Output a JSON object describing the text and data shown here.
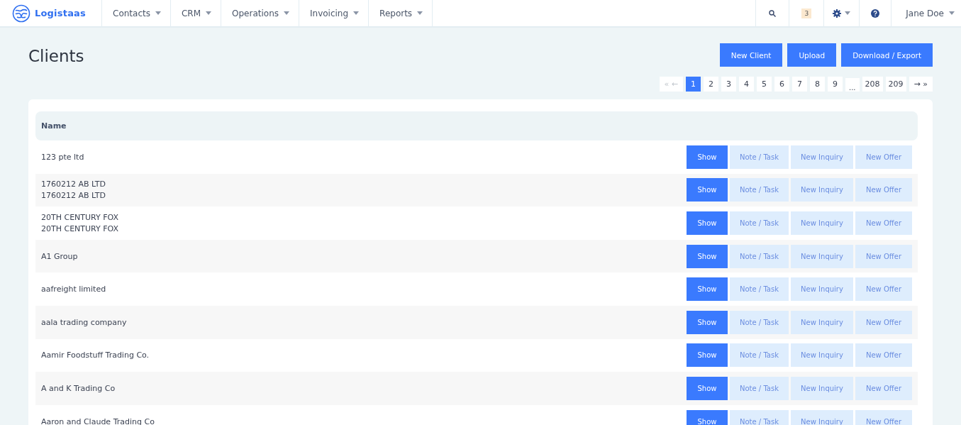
{
  "navbar": {
    "brand": "Logistaas",
    "menu": [
      {
        "label": "Contacts"
      },
      {
        "label": "CRM"
      },
      {
        "label": "Operations"
      },
      {
        "label": "Invoicing"
      },
      {
        "label": "Reports"
      }
    ],
    "notification_count": "3",
    "user": "Jane Doe"
  },
  "page": {
    "title": "Clients",
    "buttons": [
      "New Client",
      "Upload",
      "Download / Export"
    ]
  },
  "pagination": [
    {
      "kind": "prev",
      "label": "« ←",
      "disabled": true
    },
    {
      "kind": "page",
      "label": "1",
      "selected": true
    },
    {
      "kind": "page",
      "label": "2",
      "selected": false
    },
    {
      "kind": "page",
      "label": "3",
      "selected": false
    },
    {
      "kind": "page",
      "label": "4",
      "selected": false
    },
    {
      "kind": "page",
      "label": "5",
      "selected": false
    },
    {
      "kind": "page",
      "label": "6",
      "selected": false
    },
    {
      "kind": "page",
      "label": "7",
      "selected": false
    },
    {
      "kind": "page",
      "label": "8",
      "selected": false
    },
    {
      "kind": "page",
      "label": "9",
      "selected": false
    },
    {
      "kind": "ellipsis",
      "label": "..."
    },
    {
      "kind": "page",
      "label": "208",
      "selected": false
    },
    {
      "kind": "page",
      "label": "209",
      "selected": false
    },
    {
      "kind": "next",
      "label": "→ »",
      "disabled": false
    }
  ],
  "table": {
    "columns": [
      "Name"
    ],
    "rows": [
      {
        "name": [
          "123 pte ltd"
        ],
        "actions": [
          "Show",
          "Note / Task",
          "New Inquiry",
          "New Offer"
        ]
      },
      {
        "name": [
          "1760212 AB LTD",
          "1760212 AB LTD"
        ],
        "actions": [
          "Show",
          "Note / Task",
          "New Inquiry",
          "New Offer"
        ]
      },
      {
        "name": [
          "20TH CENTURY FOX",
          "20TH CENTURY FOX"
        ],
        "actions": [
          "Show",
          "Note / Task",
          "New Inquiry",
          "New Offer"
        ]
      },
      {
        "name": [
          "A1 Group"
        ],
        "actions": [
          "Show",
          "Note / Task",
          "New Inquiry",
          "New Offer"
        ]
      },
      {
        "name": [
          "aafreight limited"
        ],
        "actions": [
          "Show",
          "Note / Task",
          "New Inquiry",
          "New Offer"
        ]
      },
      {
        "name": [
          "aala trading company"
        ],
        "actions": [
          "Show",
          "Note / Task",
          "New Inquiry",
          "New Offer"
        ]
      },
      {
        "name": [
          "Aamir Foodstuff Trading Co."
        ],
        "actions": [
          "Show",
          "Note / Task",
          "New Inquiry",
          "New Offer"
        ]
      },
      {
        "name": [
          "A and K Trading Co"
        ],
        "actions": [
          "Show",
          "Note / Task",
          "New Inquiry",
          "New Offer"
        ]
      },
      {
        "name": [
          "Aaron and Claude Trading Co"
        ],
        "actions": [
          "Show",
          "Note / Task",
          "New Inquiry",
          "New Offer"
        ]
      }
    ]
  }
}
